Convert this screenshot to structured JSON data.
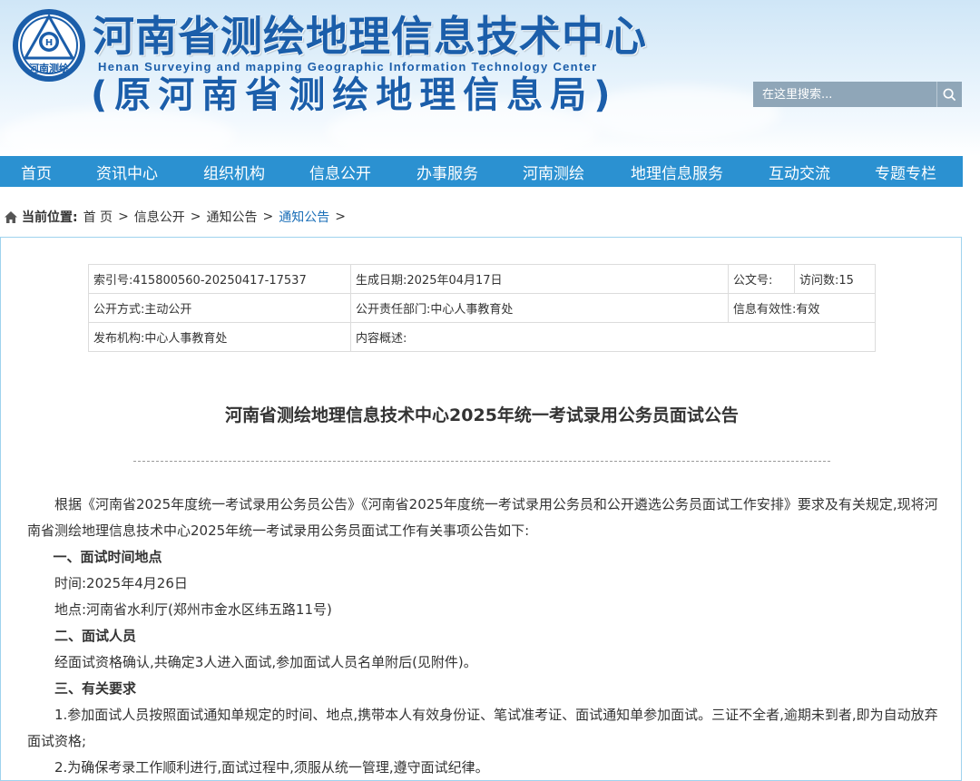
{
  "header": {
    "title": "河南省测绘地理信息技术中心",
    "subtitle_en": "Henan Surveying and mapping Geographic Information Technology Center",
    "former_name": "(原河南省测绘地理信息局)",
    "logo_text": "河南测绘",
    "logo_letter": "H"
  },
  "search": {
    "placeholder": "在这里搜索..."
  },
  "nav": {
    "items": [
      {
        "label": "首页"
      },
      {
        "label": "资讯中心"
      },
      {
        "label": "组织机构"
      },
      {
        "label": "信息公开"
      },
      {
        "label": "办事服务"
      },
      {
        "label": "河南测绘"
      },
      {
        "label": "地理信息服务"
      },
      {
        "label": "互动交流"
      },
      {
        "label": "专题专栏"
      }
    ],
    "color": "#2b91d1"
  },
  "breadcrumb": {
    "label": "当前位置:",
    "items": [
      "首 页",
      "信息公开",
      "通知公告",
      "通知公告"
    ],
    "separator": ">"
  },
  "meta": {
    "index_no": "索引号:415800560-20250417-17537",
    "gen_date": "生成日期:2025年04月17日",
    "doc_no": "公文号:",
    "visits": "访问数:15",
    "open_mode": "公开方式:主动公开",
    "dept": "公开责任部门:中心人事教育处",
    "validity": "信息有效性:有效",
    "publisher": "发布机构:中心人事教育处",
    "summary": "内容概述:"
  },
  "article": {
    "title": "河南省测绘地理信息技术中心2025年统一考试录用公务员面试公告",
    "intro": "根据《河南省2025年度统一考试录用公务员公告》《河南省2025年度统一考试录用公务员和公开遴选公务员面试工作安排》要求及有关规定,现将河南省测绘地理信息技术中心2025年统一考试录用公务员面试工作有关事项公告如下:",
    "s1_title": "一、面试时间地点",
    "s1_time": "时间:2025年4月26日",
    "s1_place": "地点:河南省水利厅(郑州市金水区纬五路11号)",
    "s2_title": "二、面试人员",
    "s2_text": "经面试资格确认,共确定3人进入面试,参加面试人员名单附后(见附件)。",
    "s3_title": "三、有关要求",
    "s3_item1": "1.参加面试人员按照面试通知单规定的时间、地点,携带本人有效身份证、笔试准考证、面试通知单参加面试。三证不全者,逾期未到者,即为自动放弃面试资格;",
    "s3_item2": "2.为确保考录工作顺利进行,面试过程中,须服从统一管理,遵守面试纪律。"
  }
}
